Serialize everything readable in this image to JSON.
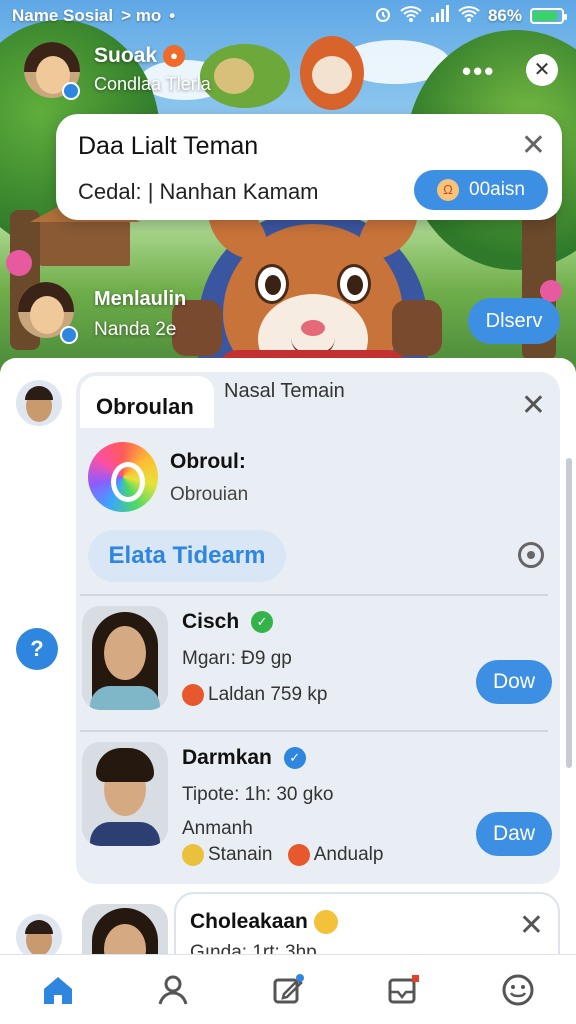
{
  "status_bar": {
    "carrier": "Name Sosial",
    "extra": "> mo",
    "battery_text": "86%",
    "battery_level": 0.86
  },
  "hero": {
    "user1_name": "Suoak",
    "user1_sub": "Condlaa Tlerla",
    "dots": "•••",
    "user2_name": "Menlaulin",
    "user2_sub": "Nanda 2e",
    "discover_label": "Dlserv"
  },
  "popup": {
    "title": "Daa Lialt Teman",
    "subtitle": "Cedal: | Nanhan Kamam",
    "action_label": "00aisn",
    "close": "✕"
  },
  "card": {
    "tab_label": "Obroulan",
    "subtitle": "Nasal Temain",
    "close": "✕",
    "brand_name": "Obroul:",
    "brand_handle": "Obrouian",
    "pill_label": "Elata Tidearm"
  },
  "friends": [
    {
      "name": "Cisch",
      "verified_color": "#34b34a",
      "line1": "Mgarı:  Ð9 gp",
      "line2": "Laldan 759 kp",
      "button": "Dow"
    },
    {
      "name": "Darmkan",
      "verified_color": "#2e86de",
      "line1": "Tipote:  1h: 30 gko",
      "line2": "Anmanh",
      "tag1": "Stanain",
      "tag2": "Andualp",
      "button": "Daw"
    }
  ],
  "card2": {
    "name": "Choleakaan",
    "sub": "Gında: 1rt: 3hp",
    "close": "✕"
  },
  "side_fab": "?",
  "colors": {
    "accent": "#2e86de",
    "button": "#3d8fe3"
  },
  "nav": [
    "home-icon",
    "profile-icon",
    "edit-icon",
    "inbox-icon",
    "smiley-icon"
  ]
}
